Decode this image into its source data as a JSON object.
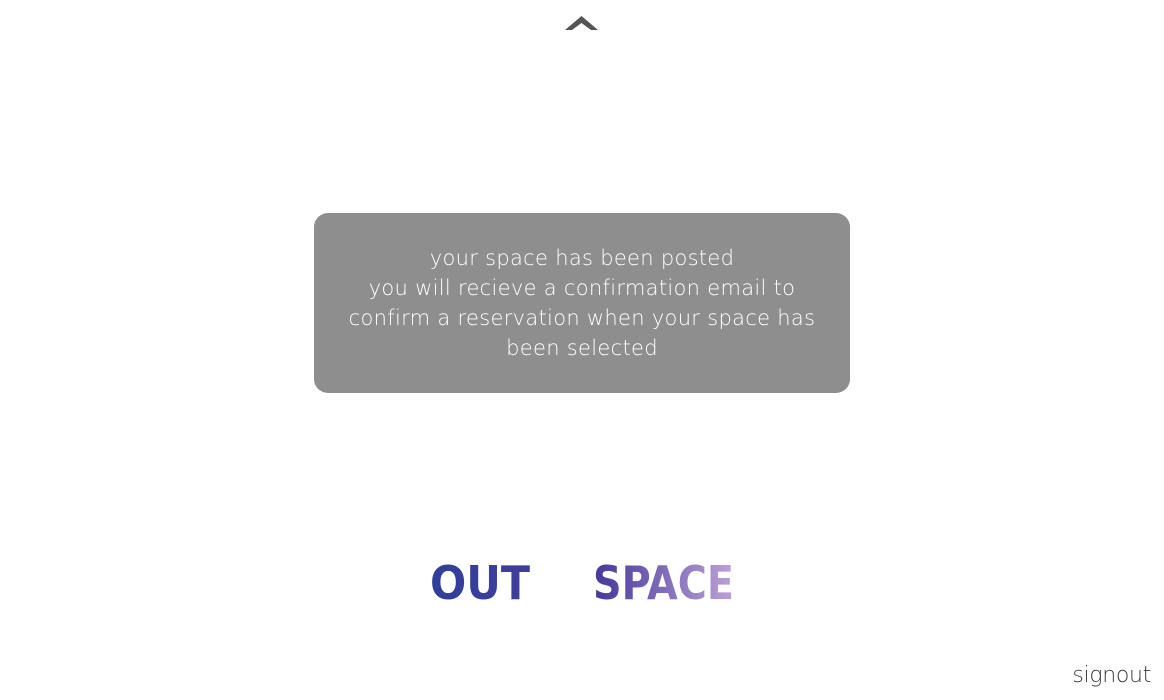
{
  "nav": {
    "up_icon": "chevron-up-icon"
  },
  "message": {
    "lines": [
      "your space has been posted",
      "you will recieve a confirmation email to",
      "confirm a reservation when your space has",
      "been selected"
    ]
  },
  "logo": {
    "word1": "OUT",
    "word2": "SPACE",
    "colors": {
      "start": "#2f3f9a",
      "mid": "#4b3c9e",
      "end": "#c2a6da"
    }
  },
  "footer": {
    "signout_label": "signout"
  },
  "colors": {
    "box_bg": "#8e8e8e",
    "arrow": "#555555",
    "signout_text": "#3b3b3b"
  }
}
